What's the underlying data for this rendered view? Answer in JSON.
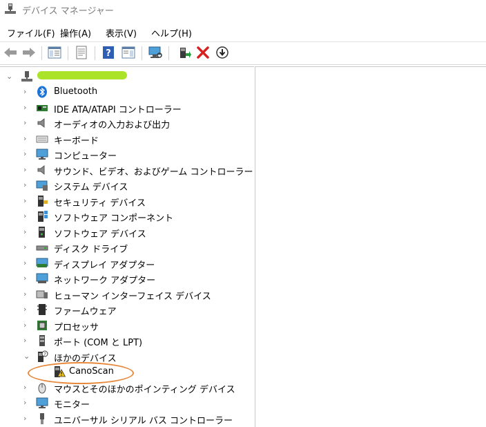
{
  "window": {
    "title": "デバイス マネージャー"
  },
  "menu": {
    "file": "ファイル(F)",
    "action": "操作(A)",
    "view": "表示(V)",
    "help": "ヘルプ(H)"
  },
  "tree": {
    "items": [
      {
        "label": "Bluetooth",
        "icon": "bluetooth-icon"
      },
      {
        "label": "IDE ATA/ATAPI コントローラー",
        "icon": "ide-controller-icon"
      },
      {
        "label": "オーディオの入力および出力",
        "icon": "speaker-icon"
      },
      {
        "label": "キーボード",
        "icon": "keyboard-icon"
      },
      {
        "label": "コンピューター",
        "icon": "monitor-icon"
      },
      {
        "label": "サウンド、ビデオ、およびゲーム コントローラー",
        "icon": "sound-icon"
      },
      {
        "label": "システム デバイス",
        "icon": "system-device-icon"
      },
      {
        "label": "セキュリティ デバイス",
        "icon": "security-device-icon"
      },
      {
        "label": "ソフトウェア コンポーネント",
        "icon": "software-component-icon"
      },
      {
        "label": "ソフトウェア デバイス",
        "icon": "software-device-icon"
      },
      {
        "label": "ディスク ドライブ",
        "icon": "disk-drive-icon"
      },
      {
        "label": "ディスプレイ アダプター",
        "icon": "display-adapter-icon"
      },
      {
        "label": "ネットワーク アダプター",
        "icon": "network-adapter-icon"
      },
      {
        "label": "ヒューマン インターフェイス デバイス",
        "icon": "hid-icon"
      },
      {
        "label": "ファームウェア",
        "icon": "firmware-icon"
      },
      {
        "label": "プロセッサ",
        "icon": "processor-icon"
      },
      {
        "label": "ポート (COM と LPT)",
        "icon": "port-icon"
      },
      {
        "label": "ほかのデバイス",
        "icon": "unknown-device-icon",
        "expanded": true
      },
      {
        "label": "CanoScan",
        "icon": "warning-device-icon",
        "child": true
      },
      {
        "label": "マウスとそのほかのポインティング デバイス",
        "icon": "mouse-icon"
      },
      {
        "label": "モニター",
        "icon": "monitor-icon"
      },
      {
        "label": "ユニバーサル シリアル バス コントローラー",
        "icon": "usb-icon"
      }
    ]
  },
  "colors": {
    "highlight": "#e8883a",
    "redacted": "#a6e21e"
  }
}
